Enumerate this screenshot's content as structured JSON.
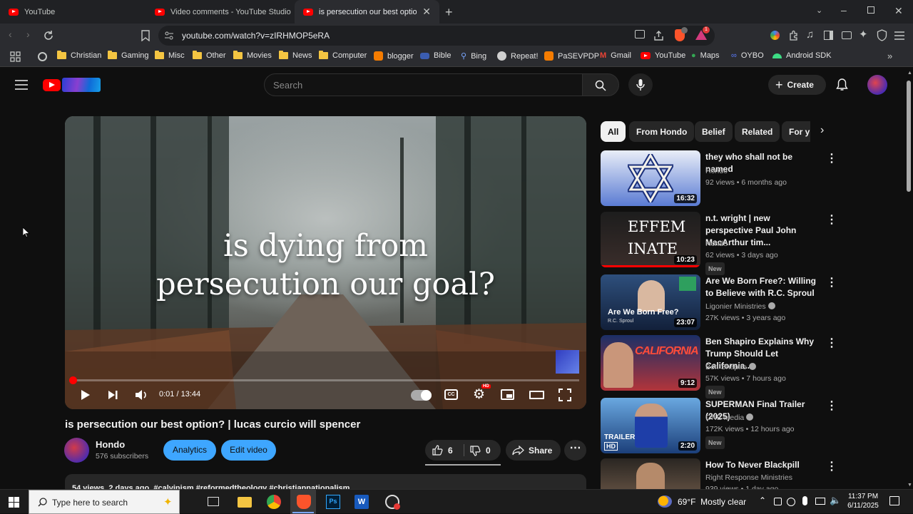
{
  "browser": {
    "tabs": [
      {
        "label": "YouTube"
      },
      {
        "label": "Video comments - YouTube Studio"
      },
      {
        "label": "is persecution our best option? |"
      }
    ],
    "url": "youtube.com/watch?v=zIRHMOP5eRA",
    "bookmarks": [
      "Christian",
      "Gaming",
      "Misc",
      "Other",
      "Movies",
      "News",
      "Computer",
      "blogger",
      "Bible",
      "Bing",
      "Repeat!",
      "PaSEVPDP",
      "Gmail",
      "YouTube",
      "Maps",
      "OYBO",
      "Android SDK"
    ],
    "notification_badge": "1"
  },
  "youtube": {
    "search_placeholder": "Search",
    "create_label": "Create",
    "chips": [
      "All",
      "From Hondo",
      "Belief",
      "Related",
      "For y"
    ],
    "player": {
      "overlay_line1": "is dying from",
      "overlay_line2": "persecution our goal?",
      "time": "0:01 / 13:44",
      "progress_fraction": 0.0012,
      "hd_badge": "HD"
    },
    "video": {
      "title": "is persecution our best option? | lucas curcio will spencer",
      "channel": "Hondo",
      "subscribers": "576 subscribers",
      "analytics_label": "Analytics",
      "edit_label": "Edit video",
      "likes": "6",
      "dislikes": "0",
      "share_label": "Share",
      "description_preview": "54 views  2 days ago  #calvinism #reformedtheology #christiannationalism"
    },
    "recommendations": [
      {
        "title": "they who shall not be named",
        "channel": "Hondo",
        "meta": "92 views  • 6 months ago",
        "duration": "16:32",
        "badge": "",
        "verified": false
      },
      {
        "title": "n.t. wright | new perspective Paul John MacArthur tim...",
        "channel": "Hondo",
        "meta": "62 views  • 3 days ago",
        "duration": "10:23",
        "badge": "New",
        "verified": false,
        "thumb_text": "EFFEM INATE"
      },
      {
        "title": "Are We Born Free?: Willing to Believe with R.C. Sproul",
        "channel": "Ligonier Ministries",
        "meta": "27K views  • 3 years ago",
        "duration": "23:07",
        "badge": "",
        "verified": true,
        "thumb_text": "Are We Born Free?",
        "thumb_sub": "R.C. Sproul"
      },
      {
        "title": "Ben Shapiro Explains Why Trump Should Let California...",
        "channel": "Ben Shapiro",
        "meta": "57K views  • 7 hours ago",
        "duration": "9:12",
        "badge": "New",
        "verified": true,
        "thumb_text": "CALIFORNIA"
      },
      {
        "title": "SUPERMAN Final Trailer (2025)",
        "channel": "ONE Media",
        "meta": "172K views  • 12 hours ago",
        "duration": "2:20",
        "badge": "New",
        "verified": true,
        "thumb_text": "TRAILER",
        "thumb_sub": "HD"
      },
      {
        "title": "How To Never Blackpill",
        "channel": "Right Response Ministries",
        "meta": "939 views  • 1 day ago",
        "duration": "",
        "badge": "",
        "verified": false
      }
    ]
  },
  "taskbar": {
    "search_placeholder": "Type here to search",
    "weather": "69°F  Mostly clear",
    "time": "11:37 PM",
    "date": "6/11/2025"
  },
  "colors": {
    "accent": "#ff0000",
    "chip_blue": "#3ea6ff",
    "bg": "#0f0f0f"
  }
}
